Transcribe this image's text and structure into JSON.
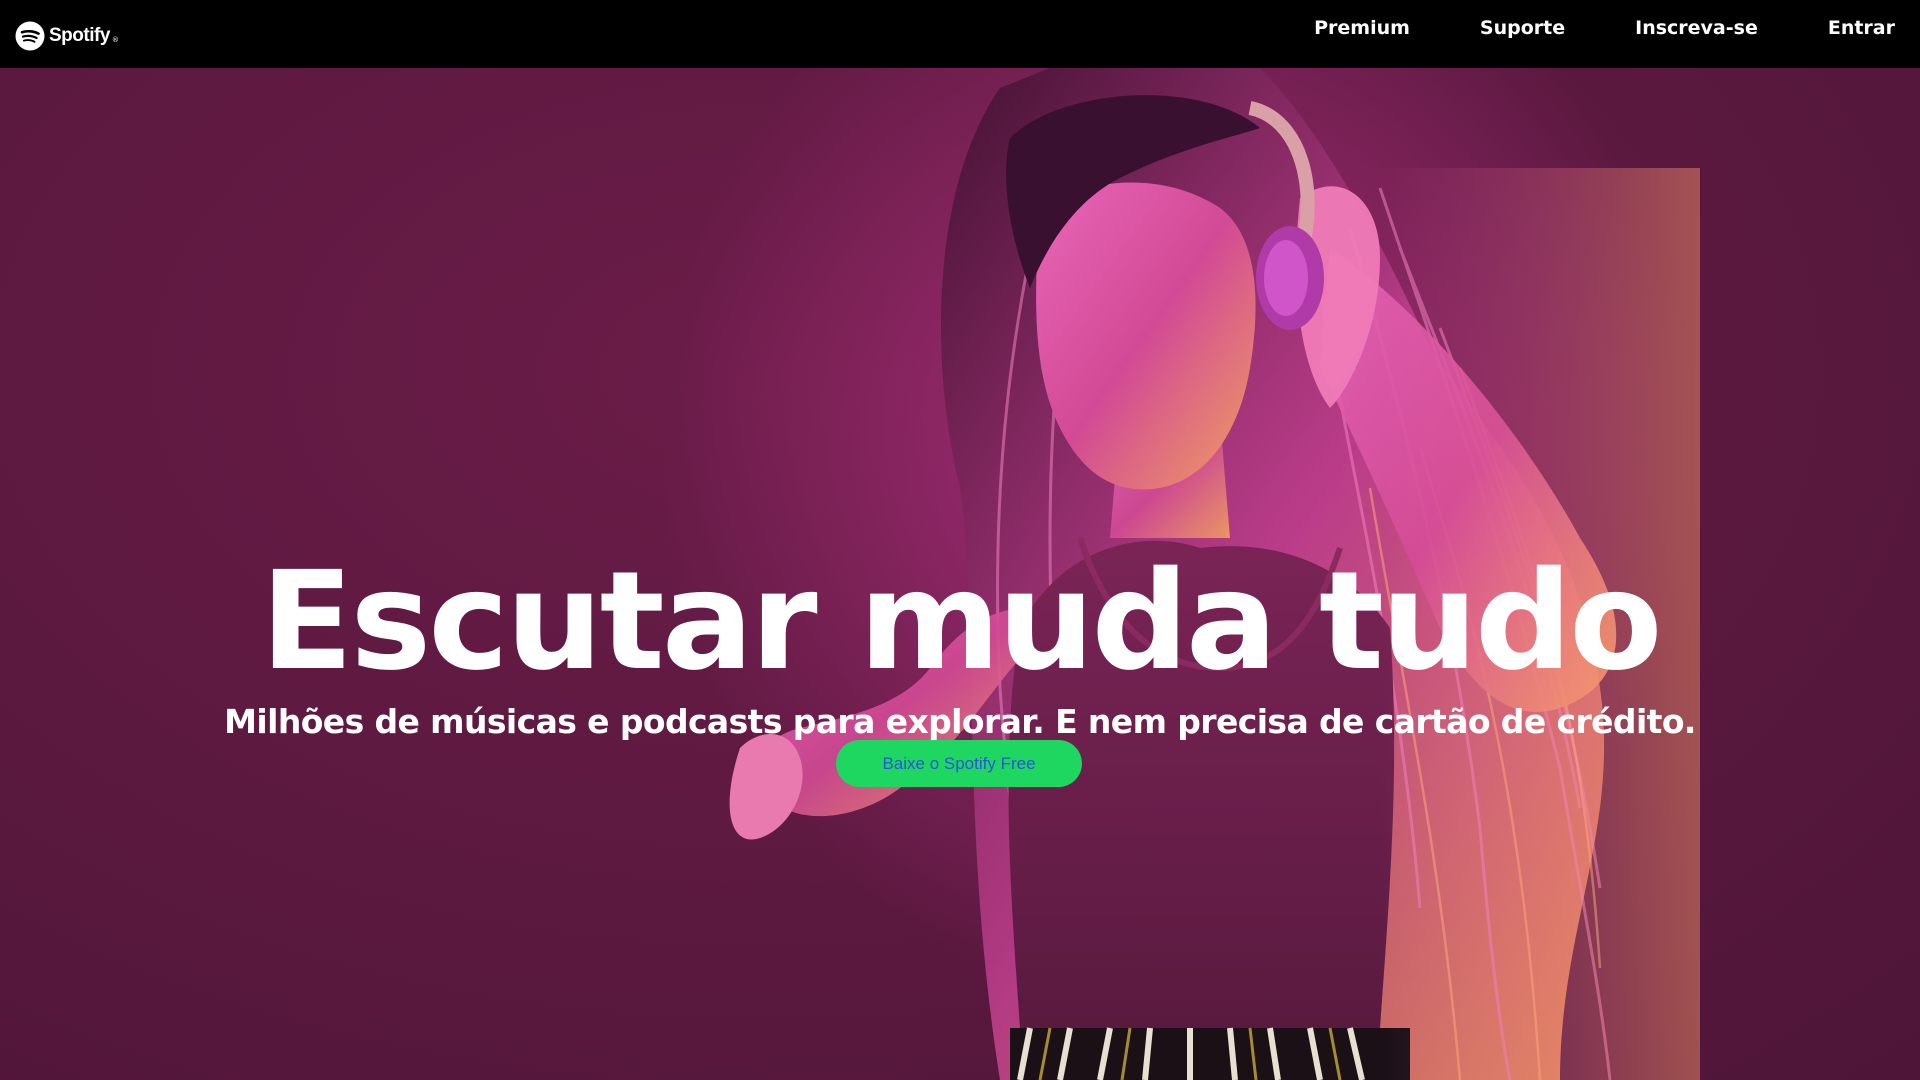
{
  "brand": {
    "name": "Spotify",
    "trademark": "®",
    "accent_color": "#1ed760",
    "nav_bg": "#000000",
    "hero_bg": "#601a42"
  },
  "nav": {
    "items": [
      {
        "label": "Premium"
      },
      {
        "label": "Suporte"
      },
      {
        "label": "Inscreva-se"
      },
      {
        "label": "Entrar"
      }
    ]
  },
  "hero": {
    "title": "Escutar muda tudo",
    "subtitle": "Milhões de músicas e podcasts para explorar. E nem precisa de cartão de crédito.",
    "cta_label": "Baixe o Spotify Free",
    "image_icon": "woman-with-headphones-photo"
  }
}
